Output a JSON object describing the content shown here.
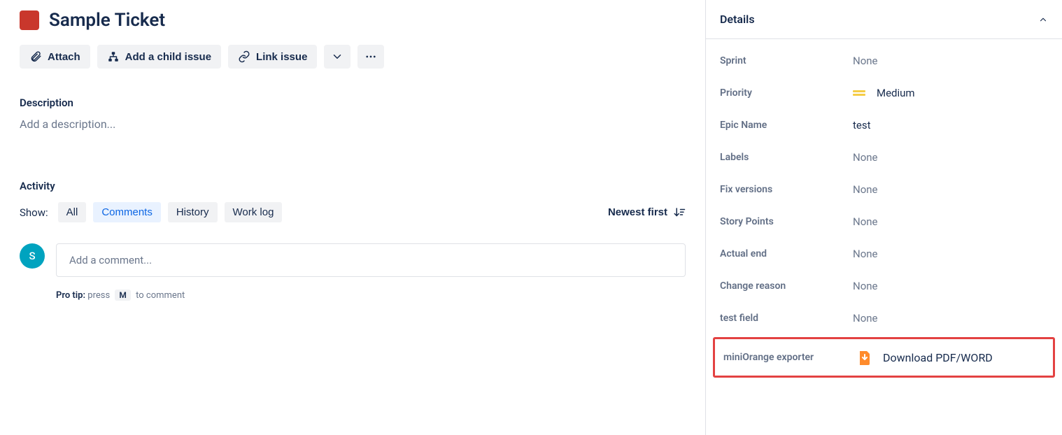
{
  "issue": {
    "title": "Sample Ticket"
  },
  "toolbar": {
    "attach": "Attach",
    "add_child": "Add a child issue",
    "link_issue": "Link issue"
  },
  "description": {
    "label": "Description",
    "placeholder": "Add a description..."
  },
  "activity": {
    "label": "Activity",
    "show": "Show:",
    "tabs": {
      "all": "All",
      "comments": "Comments",
      "history": "History",
      "worklog": "Work log"
    },
    "sort": "Newest first"
  },
  "comment": {
    "avatar": "S",
    "placeholder": "Add a comment...",
    "protip_label": "Pro tip:",
    "protip_before": "press",
    "protip_key": "M",
    "protip_after": "to comment"
  },
  "details": {
    "header": "Details",
    "fields": {
      "sprint": {
        "label": "Sprint",
        "value": "None"
      },
      "priority": {
        "label": "Priority",
        "value": "Medium"
      },
      "epic_name": {
        "label": "Epic Name",
        "value": "test"
      },
      "labels": {
        "label": "Labels",
        "value": "None"
      },
      "fix_versions": {
        "label": "Fix versions",
        "value": "None"
      },
      "story_points": {
        "label": "Story Points",
        "value": "None"
      },
      "actual_end": {
        "label": "Actual end",
        "value": "None"
      },
      "change_reason": {
        "label": "Change reason",
        "value": "None"
      },
      "test_field": {
        "label": "test field",
        "value": "None"
      },
      "exporter": {
        "label": "miniOrange exporter",
        "value": "Download PDF/WORD"
      }
    }
  }
}
